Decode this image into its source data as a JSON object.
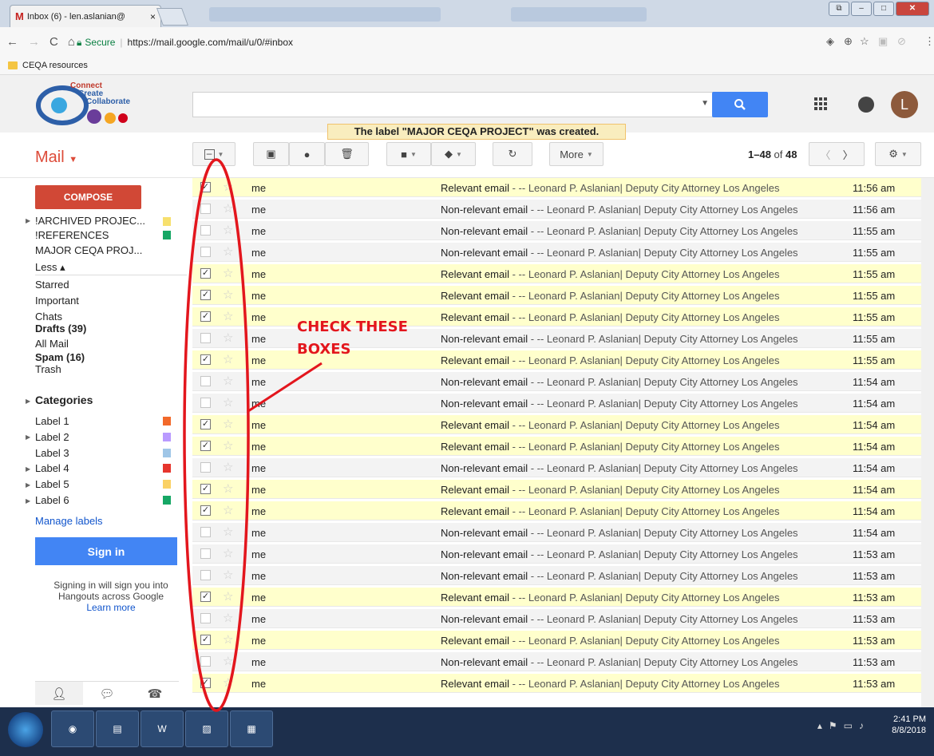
{
  "browser": {
    "tab_title": "Inbox (6) - len.aslanian@",
    "tab_close": "×",
    "secure_label": "Secure",
    "url": "https://mail.google.com/mail/u/0/#inbox",
    "bookmark": "CEQA resources"
  },
  "header": {
    "logo_lines": [
      "Connect",
      "Create",
      "Collaborate"
    ],
    "search_placeholder": "",
    "avatar_letter": "L"
  },
  "toast": "The label \"MAJOR CEQA PROJECT\" was created.",
  "toolbar": {
    "title": "Mail",
    "more_label": "More",
    "pager_range": "1–48",
    "pager_of": "of",
    "pager_total": "48"
  },
  "sidebar": {
    "compose": "COMPOSE",
    "labels": [
      {
        "label": "!ARCHIVED PROJEC...",
        "color": "#f7e06e"
      },
      {
        "label": "!REFERENCES",
        "color": "#16a765"
      },
      {
        "label": "MAJOR CEQA PROJ...",
        "color": ""
      }
    ],
    "less": "Less ▴",
    "nav": [
      "Starred",
      "Important",
      "Chats",
      "Drafts (39)",
      "All Mail",
      "Spam (16)",
      "Trash"
    ],
    "categories": "Categories",
    "custom_labels": [
      {
        "label": "Label 1",
        "color": "#f2692a"
      },
      {
        "label": "Label 2",
        "color": "#b99aff"
      },
      {
        "label": "Label 3",
        "color": "#9fc6e7"
      },
      {
        "label": "Label 4",
        "color": "#e6352d"
      },
      {
        "label": "Label 5",
        "color": "#fad165"
      },
      {
        "label": "Label 6",
        "color": "#16a765"
      }
    ],
    "manage_labels": "Manage labels",
    "sign_in": "Sign in",
    "sign_in_text": "Signing in will sign you into Hangouts across Google",
    "learn_more": "Learn more"
  },
  "emails": [
    {
      "sender": "me",
      "subject": "Relevant email",
      "preview": " - -- Leonard P. Aslanian| Deputy City Attorney Los Angeles",
      "time": "11:56 am",
      "checked": true
    },
    {
      "sender": "me",
      "subject": "Non-relevant email",
      "preview": " - -- Leonard P. Aslanian| Deputy City Attorney Los Angeles",
      "time": "11:56 am",
      "checked": false
    },
    {
      "sender": "me",
      "subject": "Non-relevant email",
      "preview": " - -- Leonard P. Aslanian| Deputy City Attorney Los Angeles",
      "time": "11:55 am",
      "checked": false
    },
    {
      "sender": "me",
      "subject": "Non-relevant email",
      "preview": " - -- Leonard P. Aslanian| Deputy City Attorney Los Angeles",
      "time": "11:55 am",
      "checked": false
    },
    {
      "sender": "me",
      "subject": "Relevant email",
      "preview": " - -- Leonard P. Aslanian| Deputy City Attorney Los Angeles",
      "time": "11:55 am",
      "checked": true
    },
    {
      "sender": "me",
      "subject": "Relevant email",
      "preview": " - -- Leonard P. Aslanian| Deputy City Attorney Los Angeles",
      "time": "11:55 am",
      "checked": true
    },
    {
      "sender": "me",
      "subject": "Relevant email",
      "preview": " - -- Leonard P. Aslanian| Deputy City Attorney Los Angeles",
      "time": "11:55 am",
      "checked": true
    },
    {
      "sender": "me",
      "subject": "Non-relevant email",
      "preview": " - -- Leonard P. Aslanian| Deputy City Attorney Los Angeles",
      "time": "11:55 am",
      "checked": false
    },
    {
      "sender": "me",
      "subject": "Relevant email",
      "preview": " - -- Leonard P. Aslanian| Deputy City Attorney Los Angeles",
      "time": "11:55 am",
      "checked": true
    },
    {
      "sender": "me",
      "subject": "Non-relevant email",
      "preview": " - -- Leonard P. Aslanian| Deputy City Attorney Los Angeles",
      "time": "11:54 am",
      "checked": false
    },
    {
      "sender": "me",
      "subject": "Non-relevant email",
      "preview": " - -- Leonard P. Aslanian| Deputy City Attorney Los Angeles",
      "time": "11:54 am",
      "checked": false
    },
    {
      "sender": "me",
      "subject": "Relevant email",
      "preview": " - -- Leonard P. Aslanian| Deputy City Attorney Los Angeles",
      "time": "11:54 am",
      "checked": true
    },
    {
      "sender": "me",
      "subject": "Relevant email",
      "preview": " - -- Leonard P. Aslanian| Deputy City Attorney Los Angeles",
      "time": "11:54 am",
      "checked": true
    },
    {
      "sender": "me",
      "subject": "Non-relevant email",
      "preview": " - -- Leonard P. Aslanian| Deputy City Attorney Los Angeles",
      "time": "11:54 am",
      "checked": false
    },
    {
      "sender": "me",
      "subject": "Relevant email",
      "preview": " - -- Leonard P. Aslanian| Deputy City Attorney Los Angeles",
      "time": "11:54 am",
      "checked": true
    },
    {
      "sender": "me",
      "subject": "Relevant email",
      "preview": " - -- Leonard P. Aslanian| Deputy City Attorney Los Angeles",
      "time": "11:54 am",
      "checked": true
    },
    {
      "sender": "me",
      "subject": "Non-relevant email",
      "preview": " - -- Leonard P. Aslanian| Deputy City Attorney Los Angeles",
      "time": "11:54 am",
      "checked": false
    },
    {
      "sender": "me",
      "subject": "Non-relevant email",
      "preview": " - -- Leonard P. Aslanian| Deputy City Attorney Los Angeles",
      "time": "11:53 am",
      "checked": false
    },
    {
      "sender": "me",
      "subject": "Non-relevant email",
      "preview": " - -- Leonard P. Aslanian| Deputy City Attorney Los Angeles",
      "time": "11:53 am",
      "checked": false
    },
    {
      "sender": "me",
      "subject": "Relevant email",
      "preview": " - -- Leonard P. Aslanian| Deputy City Attorney Los Angeles",
      "time": "11:53 am",
      "checked": true
    },
    {
      "sender": "me",
      "subject": "Non-relevant email",
      "preview": " - -- Leonard P. Aslanian| Deputy City Attorney Los Angeles",
      "time": "11:53 am",
      "checked": false
    },
    {
      "sender": "me",
      "subject": "Relevant email",
      "preview": " - -- Leonard P. Aslanian| Deputy City Attorney Los Angeles",
      "time": "11:53 am",
      "checked": true
    },
    {
      "sender": "me",
      "subject": "Non-relevant email",
      "preview": " - -- Leonard P. Aslanian| Deputy City Attorney Los Angeles",
      "time": "11:53 am",
      "checked": false
    },
    {
      "sender": "me",
      "subject": "Relevant email",
      "preview": " - -- Leonard P. Aslanian| Deputy City Attorney Los Angeles",
      "time": "11:53 am",
      "checked": true
    }
  ],
  "annotation": {
    "line1": "CHECK THESE",
    "line2": "BOXES",
    "color": "#e3161d"
  },
  "taskbar": {
    "time": "2:41 PM",
    "date": "8/8/2018"
  }
}
